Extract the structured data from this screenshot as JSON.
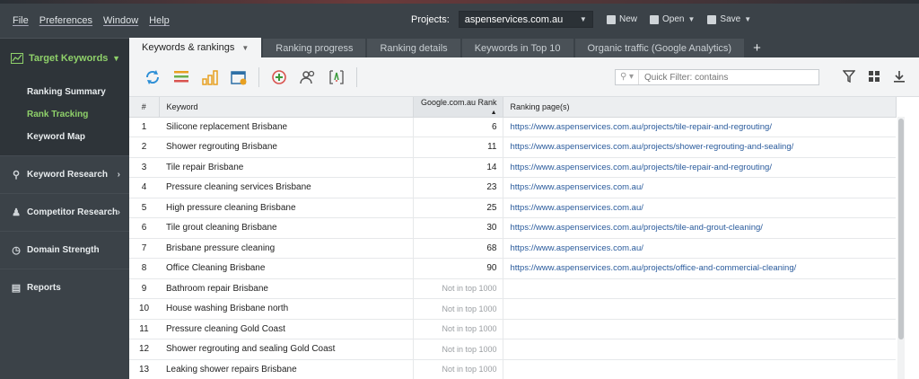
{
  "menu": [
    "File",
    "Preferences",
    "Window",
    "Help"
  ],
  "projects": {
    "label": "Projects:",
    "selected": "aspenservices.com.au"
  },
  "file_buttons": {
    "new": "New",
    "open": "Open",
    "save": "Save"
  },
  "sidebar": {
    "target": "Target Keywords",
    "sub_items": [
      "Ranking Summary",
      "Rank Tracking",
      "Keyword Map"
    ],
    "active_sub": "Rank Tracking",
    "nav": [
      {
        "label": "Keyword Research",
        "icon": "search-icon",
        "chevron": true
      },
      {
        "label": "Competitor Research",
        "icon": "person-icon",
        "chevron": true
      },
      {
        "label": "Domain Strength",
        "icon": "gauge-icon",
        "chevron": false
      },
      {
        "label": "Reports",
        "icon": "document-icon",
        "chevron": false
      }
    ]
  },
  "tabs": [
    "Keywords & rankings",
    "Ranking progress",
    "Ranking details",
    "Keywords in Top 10",
    "Organic traffic (Google Analytics)"
  ],
  "filter": {
    "placeholder": "Quick Filter: contains"
  },
  "table": {
    "headers": [
      "#",
      "Keyword",
      "Google.com.au Rank",
      "Ranking page(s)"
    ],
    "rows": [
      [
        "1",
        "Silicone replacement Brisbane",
        "6",
        "https://www.aspenservices.com.au/projects/tile-repair-and-regrouting/"
      ],
      [
        "2",
        "Shower regrouting Brisbane",
        "11",
        "https://www.aspenservices.com.au/projects/shower-regrouting-and-sealing/"
      ],
      [
        "3",
        "Tile repair Brisbane",
        "14",
        "https://www.aspenservices.com.au/projects/tile-repair-and-regrouting/"
      ],
      [
        "4",
        "Pressure cleaning services Brisbane",
        "23",
        "https://www.aspenservices.com.au/"
      ],
      [
        "5",
        "High pressure cleaning Brisbane",
        "25",
        "https://www.aspenservices.com.au/"
      ],
      [
        "6",
        "Tile grout cleaning Brisbane",
        "30",
        "https://www.aspenservices.com.au/projects/tile-and-grout-cleaning/"
      ],
      [
        "7",
        "Brisbane pressure cleaning",
        "68",
        "https://www.aspenservices.com.au/"
      ],
      [
        "8",
        "Office Cleaning Brisbane",
        "90",
        "https://www.aspenservices.com.au/projects/office-and-commercial-cleaning/"
      ],
      [
        "9",
        "Bathroom repair Brisbane",
        "Not in top 1000",
        ""
      ],
      [
        "10",
        "House washing Brisbane north",
        "Not in top 1000",
        ""
      ],
      [
        "11",
        "Pressure cleaning Gold Coast",
        "Not in top 1000",
        ""
      ],
      [
        "12",
        "Shower regrouting and sealing Gold Coast",
        "Not in top 1000",
        ""
      ],
      [
        "13",
        "Leaking shower repairs Brisbane",
        "Not in top 1000",
        ""
      ]
    ]
  },
  "colors": {
    "accent_green": "#8fd16a",
    "link": "#2a5b9c",
    "dark_bg": "#3b4248"
  }
}
